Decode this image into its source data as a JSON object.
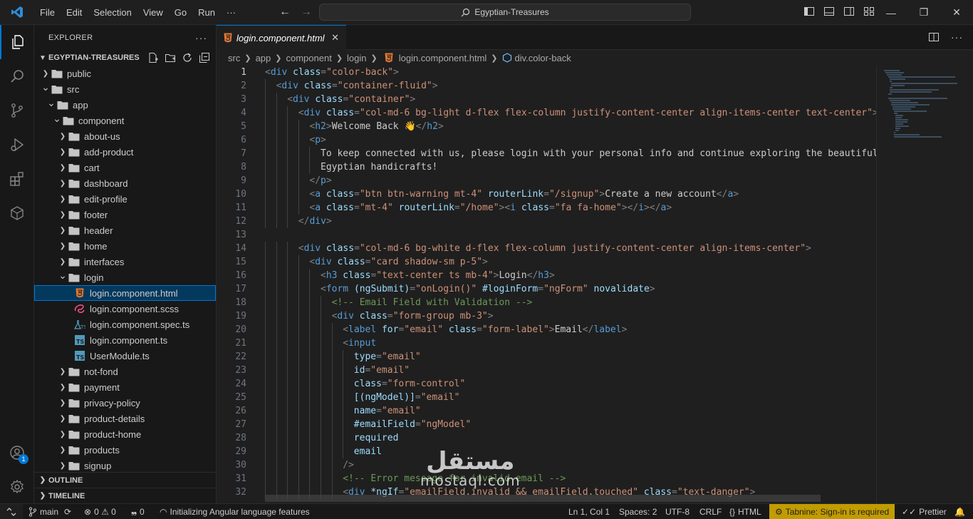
{
  "menu": [
    "File",
    "Edit",
    "Selection",
    "View",
    "Go",
    "Run",
    "···"
  ],
  "search": {
    "text": "Egyptian-Treasures"
  },
  "sidebar": {
    "title": "EXPLORER",
    "project": "EGYPTIAN-TREASURES",
    "tree": [
      {
        "label": "public",
        "depth": 1,
        "type": "folder",
        "open": false
      },
      {
        "label": "src",
        "depth": 1,
        "type": "folder",
        "open": true
      },
      {
        "label": "app",
        "depth": 2,
        "type": "folder",
        "open": true
      },
      {
        "label": "component",
        "depth": 3,
        "type": "folder",
        "open": true
      },
      {
        "label": "about-us",
        "depth": 4,
        "type": "folder",
        "open": false
      },
      {
        "label": "add-product",
        "depth": 4,
        "type": "folder",
        "open": false
      },
      {
        "label": "cart",
        "depth": 4,
        "type": "folder",
        "open": false
      },
      {
        "label": "dashboard",
        "depth": 4,
        "type": "folder",
        "open": false
      },
      {
        "label": "edit-profile",
        "depth": 4,
        "type": "folder",
        "open": false
      },
      {
        "label": "footer",
        "depth": 4,
        "type": "folder",
        "open": false
      },
      {
        "label": "header",
        "depth": 4,
        "type": "folder",
        "open": false
      },
      {
        "label": "home",
        "depth": 4,
        "type": "folder",
        "open": false
      },
      {
        "label": "interfaces",
        "depth": 4,
        "type": "folder",
        "open": false
      },
      {
        "label": "login",
        "depth": 4,
        "type": "folder",
        "open": true
      },
      {
        "label": "login.component.html",
        "depth": 5,
        "type": "html",
        "selected": true
      },
      {
        "label": "login.component.scss",
        "depth": 5,
        "type": "scss"
      },
      {
        "label": "login.component.spec.ts",
        "depth": 5,
        "type": "spec"
      },
      {
        "label": "login.component.ts",
        "depth": 5,
        "type": "ts"
      },
      {
        "label": "UserModule.ts",
        "depth": 5,
        "type": "ts"
      },
      {
        "label": "not-fond",
        "depth": 4,
        "type": "folder",
        "open": false
      },
      {
        "label": "payment",
        "depth": 4,
        "type": "folder",
        "open": false
      },
      {
        "label": "privacy-policy",
        "depth": 4,
        "type": "folder",
        "open": false
      },
      {
        "label": "product-details",
        "depth": 4,
        "type": "folder",
        "open": false
      },
      {
        "label": "product-home",
        "depth": 4,
        "type": "folder",
        "open": false
      },
      {
        "label": "products",
        "depth": 4,
        "type": "folder",
        "open": false
      },
      {
        "label": "signup",
        "depth": 4,
        "type": "folder",
        "open": false
      }
    ],
    "outline": "OUTLINE",
    "timeline": "TIMELINE"
  },
  "tab": {
    "label": "login.component.html"
  },
  "breadcrumb": [
    "src",
    "app",
    "component",
    "login",
    "login.component.html",
    "div.color-back"
  ],
  "code": [
    {
      "n": 1,
      "ind": 0,
      "t": [
        [
          "b",
          "<"
        ],
        [
          "g",
          "div"
        ],
        [
          "a",
          " class"
        ],
        [
          "b",
          "="
        ],
        [
          "s",
          "\"color-back\""
        ],
        [
          "b",
          ">"
        ]
      ]
    },
    {
      "n": 2,
      "ind": 1,
      "t": [
        [
          "b",
          "<"
        ],
        [
          "g",
          "div"
        ],
        [
          "a",
          " class"
        ],
        [
          "b",
          "="
        ],
        [
          "s",
          "\"container-fluid\""
        ],
        [
          "b",
          ">"
        ]
      ]
    },
    {
      "n": 3,
      "ind": 2,
      "t": [
        [
          "b",
          "<"
        ],
        [
          "g",
          "div"
        ],
        [
          "a",
          " class"
        ],
        [
          "b",
          "="
        ],
        [
          "s",
          "\"container\""
        ],
        [
          "b",
          ">"
        ]
      ]
    },
    {
      "n": 4,
      "ind": 3,
      "t": [
        [
          "b",
          "<"
        ],
        [
          "g",
          "div"
        ],
        [
          "a",
          " class"
        ],
        [
          "b",
          "="
        ],
        [
          "s",
          "\"col-md-6 bg-light d-flex flex-column justify-content-center align-items-center text-center\""
        ],
        [
          "b",
          ">"
        ]
      ]
    },
    {
      "n": 5,
      "ind": 4,
      "t": [
        [
          "b",
          "<"
        ],
        [
          "g",
          "h2"
        ],
        [
          "b",
          ">"
        ],
        [
          "x",
          "Welcome Back 👋"
        ],
        [
          "b",
          "</"
        ],
        [
          "g",
          "h2"
        ],
        [
          "b",
          ">"
        ]
      ]
    },
    {
      "n": 6,
      "ind": 4,
      "t": [
        [
          "b",
          "<"
        ],
        [
          "g",
          "p"
        ],
        [
          "b",
          ">"
        ]
      ]
    },
    {
      "n": 7,
      "ind": 5,
      "t": [
        [
          "x",
          "To keep connected with us, please login with your personal info and continue exploring the beautiful wo"
        ]
      ]
    },
    {
      "n": 8,
      "ind": 5,
      "t": [
        [
          "x",
          "Egyptian handicrafts!"
        ]
      ]
    },
    {
      "n": 9,
      "ind": 4,
      "t": [
        [
          "b",
          "</"
        ],
        [
          "g",
          "p"
        ],
        [
          "b",
          ">"
        ]
      ]
    },
    {
      "n": 10,
      "ind": 4,
      "t": [
        [
          "b",
          "<"
        ],
        [
          "g",
          "a"
        ],
        [
          "a",
          " class"
        ],
        [
          "b",
          "="
        ],
        [
          "s",
          "\"btn btn-warning mt-4\""
        ],
        [
          "a",
          " routerLink"
        ],
        [
          "b",
          "="
        ],
        [
          "s",
          "\"/signup\""
        ],
        [
          "b",
          ">"
        ],
        [
          "x",
          "Create a new account"
        ],
        [
          "b",
          "</"
        ],
        [
          "g",
          "a"
        ],
        [
          "b",
          ">"
        ]
      ]
    },
    {
      "n": 11,
      "ind": 4,
      "t": [
        [
          "b",
          "<"
        ],
        [
          "g",
          "a"
        ],
        [
          "a",
          " class"
        ],
        [
          "b",
          "="
        ],
        [
          "s",
          "\"mt-4\""
        ],
        [
          "a",
          " routerLink"
        ],
        [
          "b",
          "="
        ],
        [
          "s",
          "\"/home\""
        ],
        [
          "b",
          ">"
        ],
        [
          "b",
          "<"
        ],
        [
          "g",
          "i"
        ],
        [
          "a",
          " class"
        ],
        [
          "b",
          "="
        ],
        [
          "s",
          "\"fa fa-home\""
        ],
        [
          "b",
          ">"
        ],
        [
          "b",
          "</"
        ],
        [
          "g",
          "i"
        ],
        [
          "b",
          ">"
        ],
        [
          "b",
          "</"
        ],
        [
          "g",
          "a"
        ],
        [
          "b",
          ">"
        ]
      ]
    },
    {
      "n": 12,
      "ind": 3,
      "t": [
        [
          "b",
          "</"
        ],
        [
          "g",
          "div"
        ],
        [
          "b",
          ">"
        ]
      ]
    },
    {
      "n": 13,
      "ind": 0,
      "t": []
    },
    {
      "n": 14,
      "ind": 3,
      "t": [
        [
          "b",
          "<"
        ],
        [
          "g",
          "div"
        ],
        [
          "a",
          " class"
        ],
        [
          "b",
          "="
        ],
        [
          "s",
          "\"col-md-6 bg-white d-flex flex-column justify-content-center align-items-center\""
        ],
        [
          "b",
          ">"
        ]
      ]
    },
    {
      "n": 15,
      "ind": 4,
      "t": [
        [
          "b",
          "<"
        ],
        [
          "g",
          "div"
        ],
        [
          "a",
          " class"
        ],
        [
          "b",
          "="
        ],
        [
          "s",
          "\"card shadow-sm p-5\""
        ],
        [
          "b",
          ">"
        ]
      ]
    },
    {
      "n": 16,
      "ind": 5,
      "t": [
        [
          "b",
          "<"
        ],
        [
          "g",
          "h3"
        ],
        [
          "a",
          " class"
        ],
        [
          "b",
          "="
        ],
        [
          "s",
          "\"text-center ts mb-4\""
        ],
        [
          "b",
          ">"
        ],
        [
          "x",
          "Login"
        ],
        [
          "b",
          "</"
        ],
        [
          "g",
          "h3"
        ],
        [
          "b",
          ">"
        ]
      ]
    },
    {
      "n": 17,
      "ind": 5,
      "t": [
        [
          "b",
          "<"
        ],
        [
          "g",
          "form"
        ],
        [
          "a",
          " (ngSubmit)"
        ],
        [
          "b",
          "="
        ],
        [
          "s",
          "\"onLogin()\""
        ],
        [
          "a",
          " #loginForm"
        ],
        [
          "b",
          "="
        ],
        [
          "s",
          "\"ngForm\""
        ],
        [
          "a",
          " novalidate"
        ],
        [
          "b",
          ">"
        ]
      ]
    },
    {
      "n": 18,
      "ind": 6,
      "t": [
        [
          "c",
          "<!-- Email Field with Validation -->"
        ]
      ]
    },
    {
      "n": 19,
      "ind": 6,
      "t": [
        [
          "b",
          "<"
        ],
        [
          "g",
          "div"
        ],
        [
          "a",
          " class"
        ],
        [
          "b",
          "="
        ],
        [
          "s",
          "\"form-group mb-3\""
        ],
        [
          "b",
          ">"
        ]
      ]
    },
    {
      "n": 20,
      "ind": 7,
      "t": [
        [
          "b",
          "<"
        ],
        [
          "g",
          "label"
        ],
        [
          "a",
          " for"
        ],
        [
          "b",
          "="
        ],
        [
          "s",
          "\"email\""
        ],
        [
          "a",
          " class"
        ],
        [
          "b",
          "="
        ],
        [
          "s",
          "\"form-label\""
        ],
        [
          "b",
          ">"
        ],
        [
          "x",
          "Email"
        ],
        [
          "b",
          "</"
        ],
        [
          "g",
          "label"
        ],
        [
          "b",
          ">"
        ]
      ]
    },
    {
      "n": 21,
      "ind": 7,
      "t": [
        [
          "b",
          "<"
        ],
        [
          "g",
          "input"
        ]
      ]
    },
    {
      "n": 22,
      "ind": 8,
      "t": [
        [
          "a",
          "type"
        ],
        [
          "b",
          "="
        ],
        [
          "s",
          "\"email\""
        ]
      ]
    },
    {
      "n": 23,
      "ind": 8,
      "t": [
        [
          "a",
          "id"
        ],
        [
          "b",
          "="
        ],
        [
          "s",
          "\"email\""
        ]
      ]
    },
    {
      "n": 24,
      "ind": 8,
      "t": [
        [
          "a",
          "class"
        ],
        [
          "b",
          "="
        ],
        [
          "s",
          "\"form-control\""
        ]
      ]
    },
    {
      "n": 25,
      "ind": 8,
      "t": [
        [
          "a",
          "[(ngModel)]"
        ],
        [
          "b",
          "="
        ],
        [
          "s",
          "\"email\""
        ]
      ]
    },
    {
      "n": 26,
      "ind": 8,
      "t": [
        [
          "a",
          "name"
        ],
        [
          "b",
          "="
        ],
        [
          "s",
          "\"email\""
        ]
      ]
    },
    {
      "n": 27,
      "ind": 8,
      "t": [
        [
          "a",
          "#emailField"
        ],
        [
          "b",
          "="
        ],
        [
          "s",
          "\"ngModel\""
        ]
      ]
    },
    {
      "n": 28,
      "ind": 8,
      "t": [
        [
          "a",
          "required"
        ]
      ]
    },
    {
      "n": 29,
      "ind": 8,
      "t": [
        [
          "a",
          "email"
        ]
      ]
    },
    {
      "n": 30,
      "ind": 7,
      "t": [
        [
          "b",
          "/>"
        ]
      ]
    },
    {
      "n": 31,
      "ind": 7,
      "t": [
        [
          "c",
          "<!-- Error message for invalid email -->"
        ]
      ]
    },
    {
      "n": 32,
      "ind": 7,
      "t": [
        [
          "b",
          "<"
        ],
        [
          "g",
          "div"
        ],
        [
          "a",
          " *ngIf"
        ],
        [
          "b",
          "="
        ],
        [
          "s",
          "\"emailField.invalid && emailField.touched\""
        ],
        [
          "a",
          " class"
        ],
        [
          "b",
          "="
        ],
        [
          "s",
          "\"text-danger\""
        ],
        [
          "b",
          ">"
        ]
      ]
    }
  ],
  "watermark": {
    "arabic": "مستقل",
    "latin": "mostaql.com"
  },
  "status": {
    "branch": "main",
    "problems": "0 ⚠ 0",
    "ports": "0",
    "task": "Initializing Angular language features",
    "cursor": "Ln 1, Col 1",
    "spaces": "Spaces: 2",
    "encoding": "UTF-8",
    "eol": "CRLF",
    "lang": "HTML",
    "tabnine": "Tabnine: Sign-in is required",
    "prettier": "Prettier"
  },
  "accounts_badge": "1",
  "colors": {
    "accent": "#0078d4",
    "tabnine": "#c19c00"
  }
}
